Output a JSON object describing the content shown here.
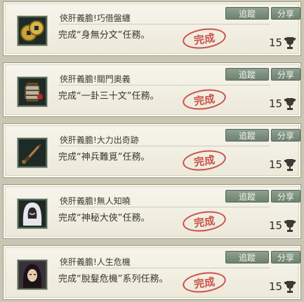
{
  "achievements": [
    {
      "title": "俠肝義膽!巧借盤纏",
      "desc": "完成“身無分文”任務。",
      "track_label": "追蹤",
      "share_label": "分享",
      "stamp_text": "完成",
      "points": "15",
      "icon": "coins-icon"
    },
    {
      "title": "俠肝義膽!關門奧義",
      "desc": "完成“一卦三十文”任務。",
      "track_label": "追蹤",
      "share_label": "分享",
      "stamp_text": "完成",
      "points": "15",
      "icon": "lantern-icon"
    },
    {
      "title": "俠肝義膽!大力出奇跡",
      "desc": "完成“神兵難覓”任務。",
      "track_label": "追蹤",
      "share_label": "分享",
      "stamp_text": "完成",
      "points": "15",
      "icon": "sword-icon"
    },
    {
      "title": "俠肝義膽!無人知曉",
      "desc": "完成“神秘大俠”任務。",
      "track_label": "追蹤",
      "share_label": "分享",
      "stamp_text": "完成",
      "points": "15",
      "icon": "hooded-figure-icon"
    },
    {
      "title": "俠肝義膽!人生危機",
      "desc": "完成“脫髮危機”系列任務。",
      "track_label": "追蹤",
      "share_label": "分享",
      "stamp_text": "完成",
      "points": "15",
      "icon": "character-portrait-icon"
    }
  ],
  "colors": {
    "button": "#7e907f",
    "stamp": "#c8413a",
    "card_bg": "#f2f0e4"
  }
}
